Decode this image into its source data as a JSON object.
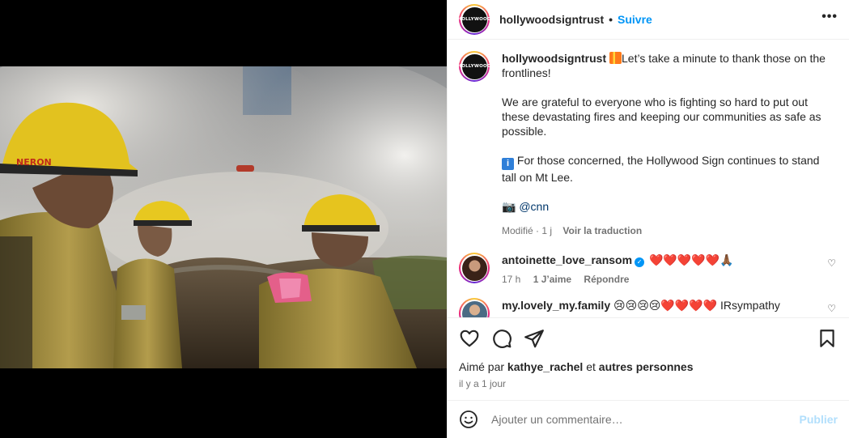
{
  "post": {
    "username": "hollywoodsigntrust",
    "follow_label": "Suivre",
    "separator": "•",
    "more_label": "•••",
    "avatar_text": "HOLLYWOOD"
  },
  "caption": {
    "username": "hollywoodsigntrust",
    "line1": "Let’s take a minute to thank those on the frontlines!",
    "line2": "We are grateful to everyone who is fighting so hard to put out these devastating fires and keeping our communities as safe as possible.",
    "line3": "For those concerned, the Hollywood Sign continues to stand tall on Mt Lee.",
    "camera_emoji": "📷",
    "mention": "@cnn",
    "modified": "Modifié · 1 j",
    "translate": "Voir la traduction"
  },
  "comments": [
    {
      "username": "antoinette_love_ransom",
      "text": "❤️❤️❤️❤️❤️🙏🏾",
      "time": "17 h",
      "likes": "1 J’aime",
      "reply": "Répondre"
    },
    {
      "username": "my.lovely_my.family",
      "text": "😢😢😢😢❤️❤️❤️❤️ IRsympathy"
    }
  ],
  "actions": {
    "liked_prefix": "Aimé par",
    "liked_user": "kathye_rachel",
    "liked_and": "et",
    "liked_others": "autres personnes",
    "time": "il y a 1 jour"
  },
  "composer": {
    "placeholder": "Ajouter un commentaire…",
    "post_label": "Publier"
  },
  "colors": {
    "accent": "#0095f6",
    "muted": "#737373",
    "post_disabled": "#b2dffc"
  }
}
